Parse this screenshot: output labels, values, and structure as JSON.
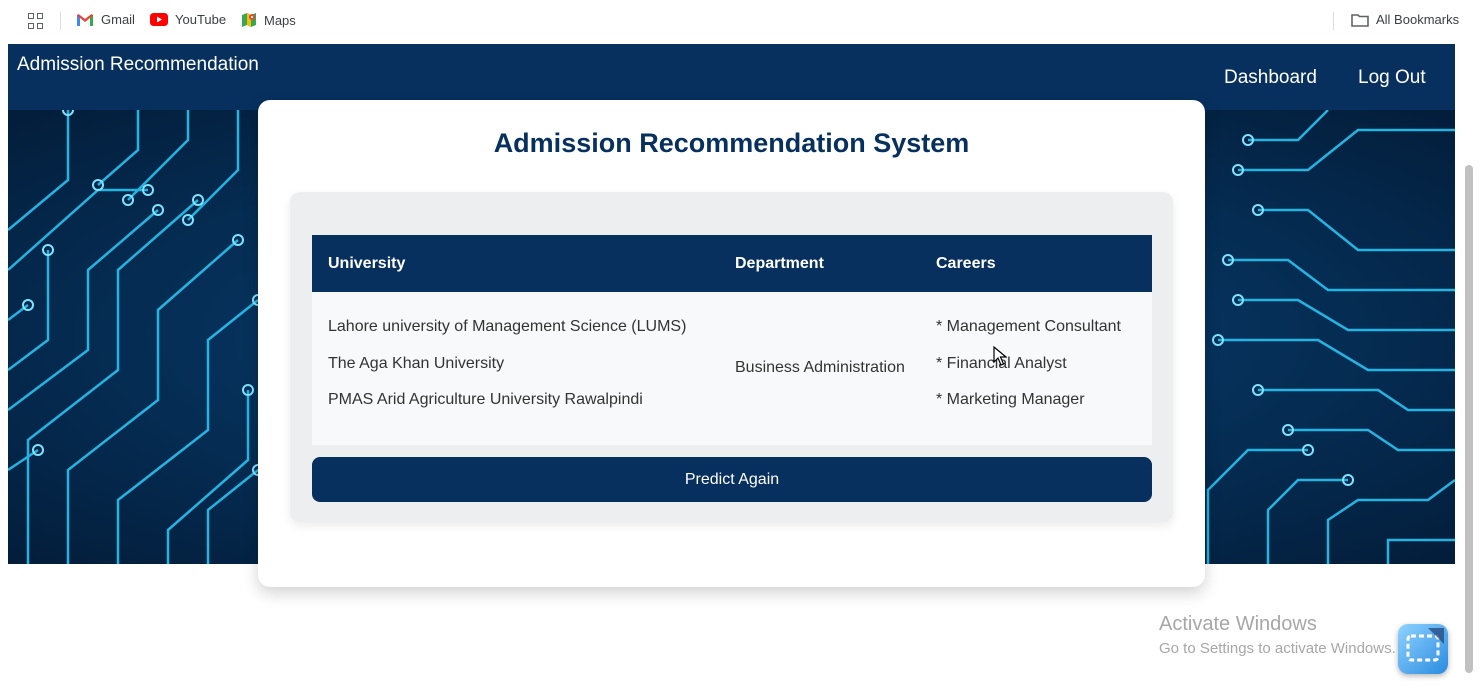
{
  "bookmarks": {
    "items": [
      {
        "label": "Gmail",
        "icon": "gmail-icon"
      },
      {
        "label": "YouTube",
        "icon": "youtube-icon"
      },
      {
        "label": "Maps",
        "icon": "maps-icon"
      }
    ],
    "all_bookmarks": "All Bookmarks"
  },
  "navbar": {
    "brand": "Admission Recommendation",
    "dashboard": "Dashboard",
    "logout": "Log Out"
  },
  "card": {
    "title": "Admission Recommendation System",
    "table": {
      "headers": [
        "University",
        "Department",
        "Careers"
      ],
      "universities": [
        "Lahore university of Management Science (LUMS)",
        "The Aga Khan University",
        "PMAS Arid Agriculture University Rawalpindi"
      ],
      "department": "Business Administration",
      "careers": [
        "* Management Consultant",
        "* Financial Analyst",
        "* Marketing Manager"
      ]
    },
    "button": "Predict Again"
  },
  "watermark": {
    "line1": "Activate Windows",
    "line2": "Go to Settings to activate Windows."
  },
  "colors": {
    "navy": "#07305f",
    "circuit": "#29c3f2"
  }
}
